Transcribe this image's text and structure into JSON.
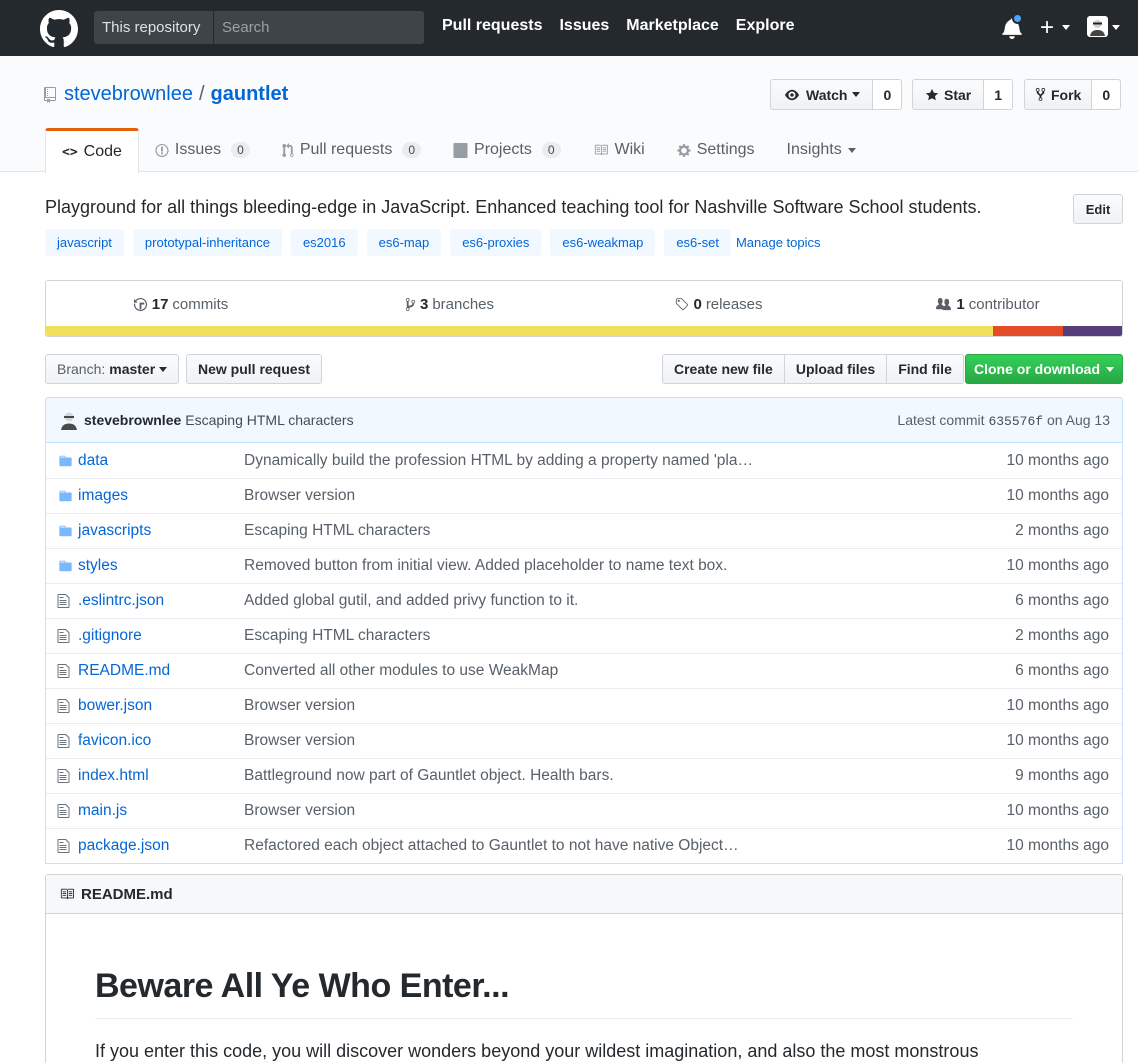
{
  "header": {
    "scope_label": "This repository",
    "search_placeholder": "Search",
    "nav": [
      "Pull requests",
      "Issues",
      "Marketplace",
      "Explore"
    ],
    "notification_color": "#4aa4ff"
  },
  "repo": {
    "owner": "stevebrownlee",
    "separator": "/",
    "name": "gauntlet",
    "watch": {
      "label": "Watch",
      "count": "0"
    },
    "star": {
      "label": "Star",
      "count": "1"
    },
    "fork": {
      "label": "Fork",
      "count": "0"
    }
  },
  "tabs": [
    {
      "label": "Code",
      "icon": "code-icon"
    },
    {
      "label": "Issues",
      "count": "0",
      "icon": "issue-icon"
    },
    {
      "label": "Pull requests",
      "count": "0",
      "icon": "pull-request-icon"
    },
    {
      "label": "Projects",
      "count": "0",
      "icon": "project-icon"
    },
    {
      "label": "Wiki",
      "icon": "book-icon"
    },
    {
      "label": "Settings",
      "icon": "gear-icon"
    },
    {
      "label": "Insights",
      "icon": "chevron-down-icon"
    }
  ],
  "description": "Playground for all things bleeding-edge in JavaScript. Enhanced teaching tool for Nashville Software School students.",
  "edit_label": "Edit",
  "topics": [
    "javascript",
    "prototypal-inheritance",
    "es2016",
    "es6-map",
    "es6-proxies",
    "es6-weakmap",
    "es6-set"
  ],
  "manage_topics": "Manage topics",
  "summary": {
    "commits": {
      "count": "17",
      "label": "commits"
    },
    "branches": {
      "count": "3",
      "label": "branches"
    },
    "releases": {
      "count": "0",
      "label": "releases"
    },
    "contributors": {
      "count": "1",
      "label": "contributor"
    },
    "languages": [
      {
        "color": "#f1e05a",
        "share": 88.0
      },
      {
        "color": "#e34c26",
        "share": 6.5
      },
      {
        "color": "#563d7c",
        "share": 5.5
      }
    ]
  },
  "file_nav": {
    "branch_label": "Branch:",
    "branch_value": "master",
    "new_pr": "New pull request",
    "create_file": "Create new file",
    "upload_files": "Upload files",
    "find_file": "Find file",
    "clone": "Clone or download"
  },
  "latest_commit": {
    "author": "stevebrownlee",
    "message": "Escaping HTML characters",
    "prefix": "Latest commit",
    "sha": "635576f",
    "date": "on Aug 13"
  },
  "files": [
    {
      "type": "dir",
      "name": "data",
      "message": "Dynamically build the profession HTML by adding a property named 'pla…",
      "age": "10 months ago"
    },
    {
      "type": "dir",
      "name": "images",
      "message": "Browser version",
      "age": "10 months ago"
    },
    {
      "type": "dir",
      "name": "javascripts",
      "message": "Escaping HTML characters",
      "age": "2 months ago"
    },
    {
      "type": "dir",
      "name": "styles",
      "message": "Removed button from initial view. Added placeholder to name text box.",
      "age": "10 months ago"
    },
    {
      "type": "file",
      "name": ".eslintrc.json",
      "message": "Added global gutil, and added privy function to it.",
      "age": "6 months ago"
    },
    {
      "type": "file",
      "name": ".gitignore",
      "message": "Escaping HTML characters",
      "age": "2 months ago"
    },
    {
      "type": "file",
      "name": "README.md",
      "message": "Converted all other modules to use WeakMap",
      "age": "6 months ago"
    },
    {
      "type": "file",
      "name": "bower.json",
      "message": "Browser version",
      "age": "10 months ago"
    },
    {
      "type": "file",
      "name": "favicon.ico",
      "message": "Browser version",
      "age": "10 months ago"
    },
    {
      "type": "file",
      "name": "index.html",
      "message": "Battleground now part of Gauntlet object. Health bars.",
      "age": "9 months ago"
    },
    {
      "type": "file",
      "name": "main.js",
      "message": "Browser version",
      "age": "10 months ago"
    },
    {
      "type": "file",
      "name": "package.json",
      "message": "Refactored each object attached to Gauntlet to not have native Object…",
      "age": "10 months ago"
    }
  ],
  "readme": {
    "filename": "README.md",
    "heading": "Beware All Ye Who Enter...",
    "paragraph": "If you enter this code, you will discover wonders beyond your wildest imagination, and also the most monstrous"
  }
}
